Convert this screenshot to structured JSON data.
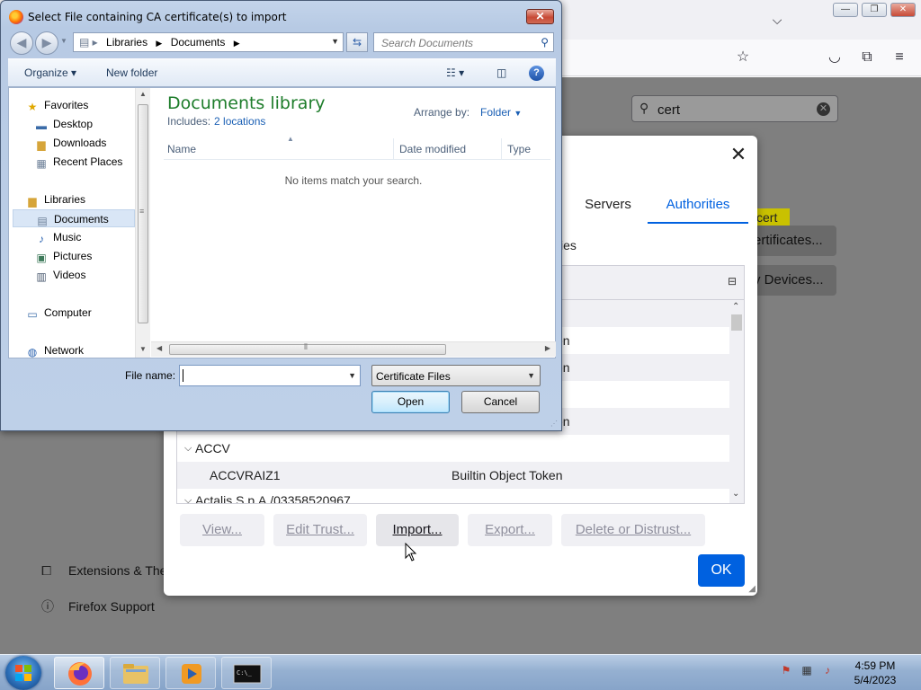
{
  "file_dialog": {
    "title": "Select File containing CA certificate(s) to import",
    "close_glyph": "✕",
    "breadcrumb": [
      "Libraries",
      "Documents"
    ],
    "search_placeholder": "Search Documents",
    "toolbar": {
      "organize": "Organize ▾",
      "new_folder": "New folder"
    },
    "nav": {
      "favorites": "Favorites",
      "desktop": "Desktop",
      "downloads": "Downloads",
      "recent_places": "Recent Places",
      "libraries": "Libraries",
      "documents": "Documents",
      "music": "Music",
      "pictures": "Pictures",
      "videos": "Videos",
      "computer": "Computer",
      "network": "Network"
    },
    "library_title": "Documents library",
    "includes_label": "Includes:",
    "includes_link": "2 locations",
    "arrange_label": "Arrange by:",
    "arrange_value": "Folder",
    "columns": [
      "Name",
      "Date modified",
      "Type"
    ],
    "empty_message": "No items match your search.",
    "file_name_label": "File name:",
    "file_name_value": "",
    "file_type": "Certificate Files",
    "open_label": "Open",
    "cancel_label": "Cancel"
  },
  "firefox": {
    "search_value": "cert",
    "cert_highlight": "cert",
    "view_certificates_partial": "ertificates...",
    "security_devices_partial": "y Devices...",
    "extensions_partial": "Extensions & The",
    "support": "Firefox Support"
  },
  "cert_manager": {
    "close_glyph": "✕",
    "tabs": {
      "servers": "Servers",
      "authorities": "Authorities"
    },
    "desc_partial": "ities",
    "rows": [
      {
        "name": "",
        "token": "en",
        "alt": true
      },
      {
        "name": "",
        "token": "en",
        "alt": false
      },
      {
        "name": "",
        "token": "",
        "alt": true
      },
      {
        "name": "",
        "token": "en",
        "alt": false
      }
    ],
    "group_accv": "ACCV",
    "row_accv": {
      "name": "ACCVRAIZ1",
      "token": "Builtin Object Token"
    },
    "group_actalis_partial": "Actalis S.p.A./03358520967",
    "buttons": {
      "view": "View...",
      "edit_trust": "Edit Trust...",
      "import": "Import...",
      "export": "Export...",
      "delete": "Delete or Distrust..."
    },
    "ok": "OK"
  },
  "taskbar": {
    "time": "4:59 PM",
    "date": "5/4/2023"
  },
  "colors": {
    "firefox_blue": "#0061e0",
    "library_green": "#1e7d2b",
    "taskbar": "#95b0d1"
  }
}
